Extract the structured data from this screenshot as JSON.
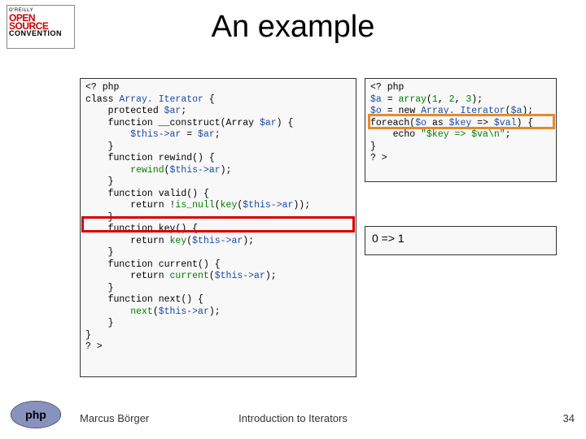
{
  "logo_oreilly": {
    "line1": "O'REILLY",
    "line2": "OPEN",
    "line3": "SOURCE",
    "line4": "CONVENTION"
  },
  "title": "An example",
  "code_left": {
    "l01": "<? php",
    "l02_a": "class ",
    "l02_b": "Array. Iterator ",
    "l02_c": "{",
    "l03_a": "    protected ",
    "l03_b": "$ar",
    "l03_c": ";",
    "l04_a": "    function ",
    "l04_b": "__construct",
    "l04_c": "(Array ",
    "l04_d": "$ar",
    "l04_e": ") {",
    "l05_a": "        ",
    "l05_b": "$this->ar ",
    "l05_c": "= ",
    "l05_d": "$ar",
    "l05_e": ";",
    "l06": "    }",
    "l07_a": "    function ",
    "l07_b": "rewind",
    "l07_c": "() {",
    "l08_a": "        ",
    "l08_b": "rewind",
    "l08_c": "(",
    "l08_d": "$this->ar",
    "l08_e": ");",
    "l09": "    }",
    "l10_a": "    function ",
    "l10_b": "valid",
    "l10_c": "() {",
    "l11_a": "        return !",
    "l11_b": "is_null",
    "l11_c": "(",
    "l11_d": "key",
    "l11_e": "(",
    "l11_f": "$this->ar",
    "l11_g": "));",
    "l12": "    }",
    "l13_a": "    function ",
    "l13_b": "key",
    "l13_c": "() {",
    "l14_a": "        return ",
    "l14_b": "key",
    "l14_c": "(",
    "l14_d": "$this->ar",
    "l14_e": ");",
    "l15": "    }",
    "l16_a": "    function ",
    "l16_b": "current",
    "l16_c": "() {",
    "l17_a": "        return ",
    "l17_b": "current",
    "l17_c": "(",
    "l17_d": "$this->ar",
    "l17_e": ");",
    "l18": "    }",
    "l19_a": "    function ",
    "l19_b": "next",
    "l19_c": "() {",
    "l20_a": "        ",
    "l20_b": "next",
    "l20_c": "(",
    "l20_d": "$this->ar",
    "l20_e": ");",
    "l21": "    }",
    "l22": "}",
    "l23": "? >"
  },
  "code_right": {
    "l01": "<? php",
    "l02_a": "$a ",
    "l02_b": "= ",
    "l02_c": "array",
    "l02_d": "(",
    "l02_e": "1",
    "l02_f": ", ",
    "l02_g": "2",
    "l02_h": ", ",
    "l02_i": "3",
    "l02_j": ");",
    "l03_a": "$o ",
    "l03_b": "= new ",
    "l03_c": "Array. Iterator",
    "l03_d": "(",
    "l03_e": "$a",
    "l03_f": ");",
    "l04_a": "foreach(",
    "l04_b": "$o ",
    "l04_c": "as ",
    "l04_d": "$key ",
    "l04_e": "=> ",
    "l04_f": "$val",
    "l04_g": ") {",
    "l05_a": "    echo ",
    "l05_b": "\"$key => $va\\n\"",
    "l05_c": ";",
    "l06": "}",
    "l07": "? >"
  },
  "output": "0 => 1",
  "footer": {
    "author": "Marcus Börger",
    "title": "Introduction to Iterators",
    "page": "34"
  }
}
